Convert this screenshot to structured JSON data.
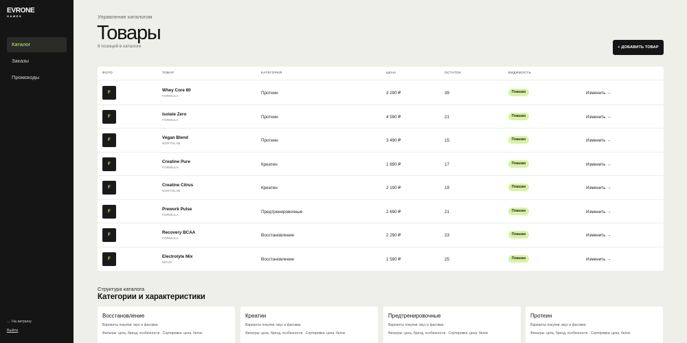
{
  "brand": {
    "logo": "EVRONE",
    "logo_sub": "GAMES"
  },
  "sidebar": {
    "items": [
      {
        "label": "Каталог",
        "active": true
      },
      {
        "label": "Заказы",
        "active": false
      },
      {
        "label": "Промокоды",
        "active": false
      }
    ],
    "storefront_link": "← На витрину",
    "logout": "Выйти"
  },
  "header": {
    "eyebrow": "Управление каталогом",
    "title": "Товары",
    "subtitle": "8 позиций в каталоге",
    "add_button": "+ ДОБАВИТЬ ТОВАР"
  },
  "table": {
    "columns": [
      "ФОТО",
      "ТОВАР",
      "КАТЕГОРИЯ",
      "ЦЕНА",
      "ОСТАТОК",
      "ВИДИМОСТЬ"
    ],
    "thumb_letter": "F",
    "edit_label": "Изменить →",
    "rows": [
      {
        "name": "Whey Core 80",
        "brand": "FORMULA",
        "category": "Протеин",
        "price": "3 290 ₽",
        "stock": "39",
        "visibility": "Показан"
      },
      {
        "name": "Isolate Zero",
        "brand": "FORMULA",
        "category": "Протеин",
        "price": "4 590 ₽",
        "stock": "21",
        "visibility": "Показан"
      },
      {
        "name": "Vegan Blend",
        "brand": "NORTHLAB",
        "category": "Протеин",
        "price": "3 490 ₽",
        "stock": "15",
        "visibility": "Показан"
      },
      {
        "name": "Creatine Pure",
        "brand": "FORMULA",
        "category": "Креатин",
        "price": "1 890 ₽",
        "stock": "17",
        "visibility": "Показан"
      },
      {
        "name": "Creatine Citrus",
        "brand": "NORTHLAB",
        "category": "Креатин",
        "price": "2 190 ₽",
        "stock": "19",
        "visibility": "Показан"
      },
      {
        "name": "Prework Pulse",
        "brand": "FORMULA",
        "category": "Предтренировочные",
        "price": "2 690 ₽",
        "stock": "21",
        "visibility": "Показан"
      },
      {
        "name": "Recovery BCAA",
        "brand": "FORMULA",
        "category": "Восстановление",
        "price": "2 290 ₽",
        "stock": "23",
        "visibility": "Показан"
      },
      {
        "name": "Electrolyte Mix",
        "brand": "MOVE",
        "category": "Восстановление",
        "price": "1 590 ₽",
        "stock": "25",
        "visibility": "Показан"
      }
    ]
  },
  "structure": {
    "eyebrow": "Структура каталога",
    "title": "Категории и характеристики",
    "cards": [
      {
        "name": "Восстановление",
        "variants": "Варианты покупки: вкус и фасовка",
        "filters": "Фильтры: цель, бренд, особенности · Сортировка: цена, белок"
      },
      {
        "name": "Креатин",
        "variants": "Варианты покупки: вкус и фасовка",
        "filters": "Фильтры: цель, бренд, особенности · Сортировка: цена, белок"
      },
      {
        "name": "Предтренировочные",
        "variants": "Варианты покупки: вкус и фасовка",
        "filters": "Фильтры: цель, бренд, особенности · Сортировка: цена, белок"
      },
      {
        "name": "Протеин",
        "variants": "Варианты покупки: вкус и фасовка",
        "filters": "Фильтры: цель, бренд, особенности · Сортировка: цена, белок"
      }
    ]
  },
  "colors": {
    "sidebar_bg": "#151515",
    "accent": "#c8f27a",
    "badge_bg": "#d9f2a5",
    "page_bg": "#efefea"
  }
}
